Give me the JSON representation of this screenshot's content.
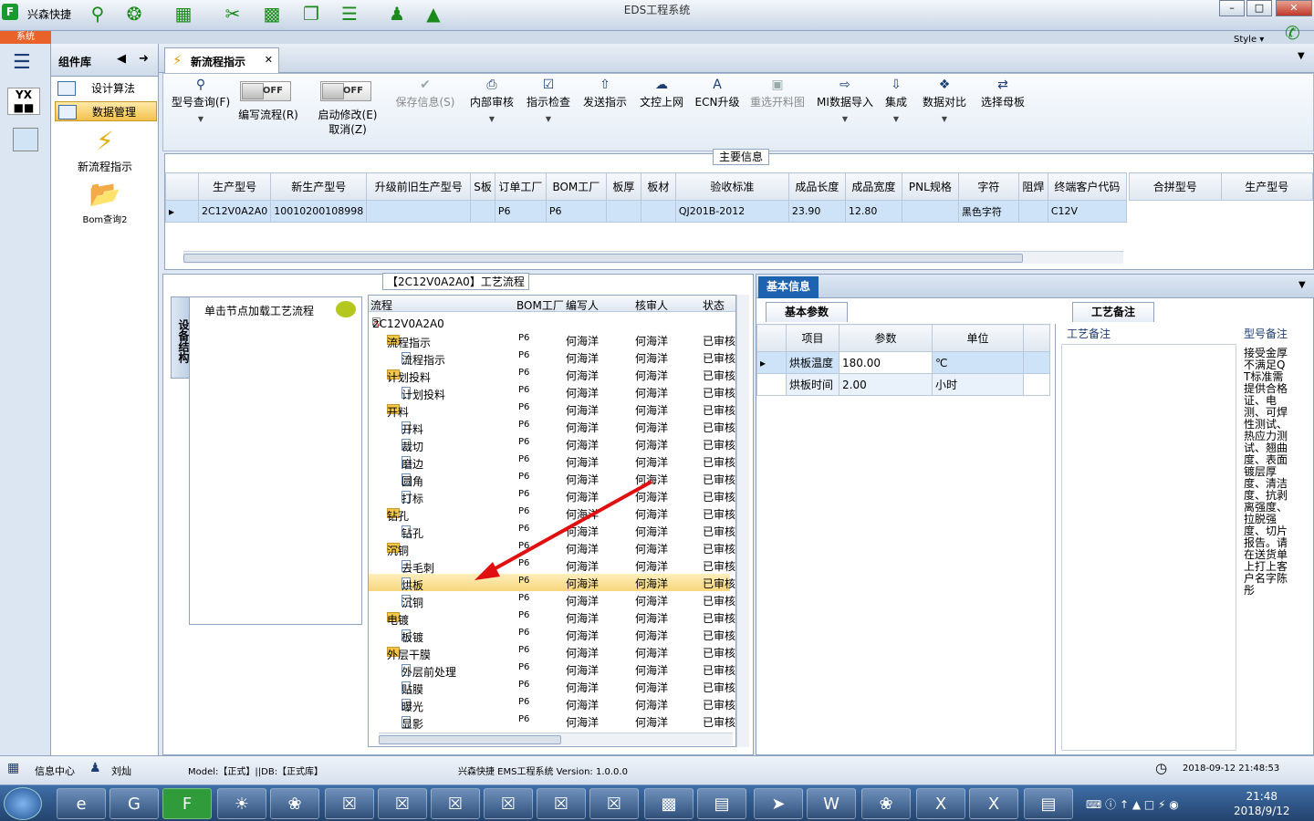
{
  "window": {
    "app_name": "兴森快捷",
    "title": "EDS工程系统",
    "system_tab": "系统",
    "style_label": "Style",
    "quick_icons": [
      "search-icon",
      "compass-icon",
      "grid-icon",
      "scissors-icon",
      "film-icon",
      "copy-icon",
      "list-icon",
      "user-icon",
      "chart-icon"
    ]
  },
  "sidebar": {
    "title": "组件库",
    "items": [
      {
        "label": "设计算法"
      },
      {
        "label": "数据管理"
      }
    ],
    "big_items": [
      {
        "label": "新流程指示"
      },
      {
        "label": "Bom查询2"
      }
    ]
  },
  "tab": {
    "label": "新流程指示"
  },
  "ribbon": {
    "buttons": [
      {
        "label": "型号查询(F)",
        "icon": "search-icon"
      },
      {
        "label": "保存信息(S)",
        "icon": "check-icon"
      },
      {
        "label": "内部审核",
        "icon": "print-icon"
      },
      {
        "label": "指示检查",
        "icon": "checkbox-icon"
      },
      {
        "label": "发送指示",
        "icon": "upload-icon"
      },
      {
        "label": "文控上网",
        "icon": "cloud-icon"
      },
      {
        "label": "ECN升级",
        "icon": "ecn-icon"
      },
      {
        "label": "重选开料图",
        "icon": "image-icon"
      },
      {
        "label": "MI数据导入",
        "icon": "import-icon"
      },
      {
        "label": "集成",
        "icon": "download-icon"
      },
      {
        "label": "数据对比",
        "icon": "compare-icon"
      },
      {
        "label": "选择母板",
        "icon": "shuffle-icon"
      }
    ],
    "toggles": [
      {
        "state": "OFF",
        "label": "编写流程(R)"
      },
      {
        "state": "OFF",
        "label": "启动修改(E)",
        "label2": "取消(Z)"
      }
    ]
  },
  "main_info": {
    "title": "主要信息",
    "columns": [
      "生产型号",
      "新生产型号",
      "升级前旧生产型号",
      "S板",
      "订单工厂",
      "BOM工厂",
      "板厚",
      "板材",
      "验收标准",
      "成品长度",
      "成品宽度",
      "PNL规格",
      "字符",
      "阻焊",
      "终端客户代码"
    ],
    "row": [
      "2C12V0A2A0",
      "10010200108998",
      "",
      "",
      "P6",
      "P6",
      "",
      "",
      "QJ201B-2012",
      "23.90",
      "12.80",
      "",
      "黑色字符",
      "",
      "C12V"
    ],
    "side_columns": [
      "合拼型号",
      "生产型号"
    ]
  },
  "flow": {
    "title": "【2C12V0A2A0】工艺流程",
    "vtab": "设备结构",
    "hint": "单击节点加载工艺流程",
    "columns": [
      "流程",
      "BOM工厂",
      "编写人",
      "核审人",
      "状态"
    ],
    "root": "2C12V0A2A0",
    "rows": [
      {
        "label": "流程指示",
        "level": 1,
        "folder": true,
        "bom": "P6",
        "writer": "何海洋",
        "reviewer": "何海洋",
        "status": "已审核"
      },
      {
        "label": "流程指示",
        "level": 2,
        "folder": false,
        "bom": "P6",
        "writer": "何海洋",
        "reviewer": "何海洋",
        "status": "已审核"
      },
      {
        "label": "计划投料",
        "level": 1,
        "folder": true,
        "bom": "P6",
        "writer": "何海洋",
        "reviewer": "何海洋",
        "status": "已审核"
      },
      {
        "label": "计划投料",
        "level": 2,
        "folder": false,
        "bom": "P6",
        "writer": "何海洋",
        "reviewer": "何海洋",
        "status": "已审核"
      },
      {
        "label": "开料",
        "level": 1,
        "folder": true,
        "bom": "P6",
        "writer": "何海洋",
        "reviewer": "何海洋",
        "status": "已审核"
      },
      {
        "label": "开料",
        "level": 2,
        "folder": false,
        "bom": "P6",
        "writer": "何海洋",
        "reviewer": "何海洋",
        "status": "已审核"
      },
      {
        "label": "裁切",
        "level": 2,
        "folder": false,
        "bom": "P6",
        "writer": "何海洋",
        "reviewer": "何海洋",
        "status": "已审核"
      },
      {
        "label": "磨边",
        "level": 2,
        "folder": false,
        "bom": "P6",
        "writer": "何海洋",
        "reviewer": "何海洋",
        "status": "已审核"
      },
      {
        "label": "圆角",
        "level": 2,
        "folder": false,
        "bom": "P6",
        "writer": "何海洋",
        "reviewer": "何海洋",
        "status": "已审核"
      },
      {
        "label": "打标",
        "level": 2,
        "folder": false,
        "bom": "P6",
        "writer": "何海洋",
        "reviewer": "何海洋",
        "status": "已审核"
      },
      {
        "label": "钻孔",
        "level": 1,
        "folder": true,
        "bom": "P6",
        "writer": "何海洋",
        "reviewer": "何海洋",
        "status": "已审核"
      },
      {
        "label": "钻孔",
        "level": 2,
        "folder": false,
        "bom": "P6",
        "writer": "何海洋",
        "reviewer": "何海洋",
        "status": "已审核"
      },
      {
        "label": "沉铜",
        "level": 1,
        "folder": true,
        "bom": "P6",
        "writer": "何海洋",
        "reviewer": "何海洋",
        "status": "已审核"
      },
      {
        "label": "去毛刺",
        "level": 2,
        "folder": false,
        "bom": "P6",
        "writer": "何海洋",
        "reviewer": "何海洋",
        "status": "已审核"
      },
      {
        "label": "烘板",
        "level": 2,
        "folder": false,
        "bom": "P6",
        "writer": "何海洋",
        "reviewer": "何海洋",
        "status": "已审核",
        "selected": true
      },
      {
        "label": "沉铜",
        "level": 2,
        "folder": false,
        "bom": "P6",
        "writer": "何海洋",
        "reviewer": "何海洋",
        "status": "已审核"
      },
      {
        "label": "电镀",
        "level": 1,
        "folder": true,
        "bom": "P6",
        "writer": "何海洋",
        "reviewer": "何海洋",
        "status": "已审核"
      },
      {
        "label": "板镀",
        "level": 2,
        "folder": false,
        "bom": "P6",
        "writer": "何海洋",
        "reviewer": "何海洋",
        "status": "已审核"
      },
      {
        "label": "外层干膜",
        "level": 1,
        "folder": true,
        "bom": "P6",
        "writer": "何海洋",
        "reviewer": "何海洋",
        "status": "已审核"
      },
      {
        "label": "外层前处理",
        "level": 2,
        "folder": false,
        "bom": "P6",
        "writer": "何海洋",
        "reviewer": "何海洋",
        "status": "已审核"
      },
      {
        "label": "贴膜",
        "level": 2,
        "folder": false,
        "bom": "P6",
        "writer": "何海洋",
        "reviewer": "何海洋",
        "status": "已审核"
      },
      {
        "label": "曝光",
        "level": 2,
        "folder": false,
        "bom": "P6",
        "writer": "何海洋",
        "reviewer": "何海洋",
        "status": "已审核"
      },
      {
        "label": "显影",
        "level": 2,
        "folder": false,
        "bom": "P6",
        "writer": "何海洋",
        "reviewer": "何海洋",
        "status": "已审核"
      }
    ]
  },
  "basic": {
    "tab": "基本信息",
    "param_tab": "基本参数",
    "columns": [
      "项目",
      "参数",
      "单位"
    ],
    "rows": [
      {
        "item": "烘板温度",
        "value": "180.00",
        "unit": "℃"
      },
      {
        "item": "烘板时间",
        "value": "2.00",
        "unit": "小时"
      }
    ],
    "remark_tab": "工艺备注",
    "remark_header": "工艺备注",
    "model_remark_header": "型号备注",
    "model_remark": "接受金厚不满足QT标准需提供合格证、电测、可焊性测试、热应力测试、翘曲度、表面镀层厚度、清洁度、抗剥离强度、拉脱强度、切片报告。请在送货单上打上客户名字陈彤"
  },
  "status": {
    "info_center": "信息中心",
    "user": "刘灿",
    "model": "Model:【正式】||DB:【正式库】",
    "version": "兴森快捷 EMS工程系统 Version: 1.0.0.0",
    "datetime": "2018-09-12 21:48:53"
  },
  "taskbar": {
    "time": "21:48",
    "date": "2018/9/12"
  }
}
